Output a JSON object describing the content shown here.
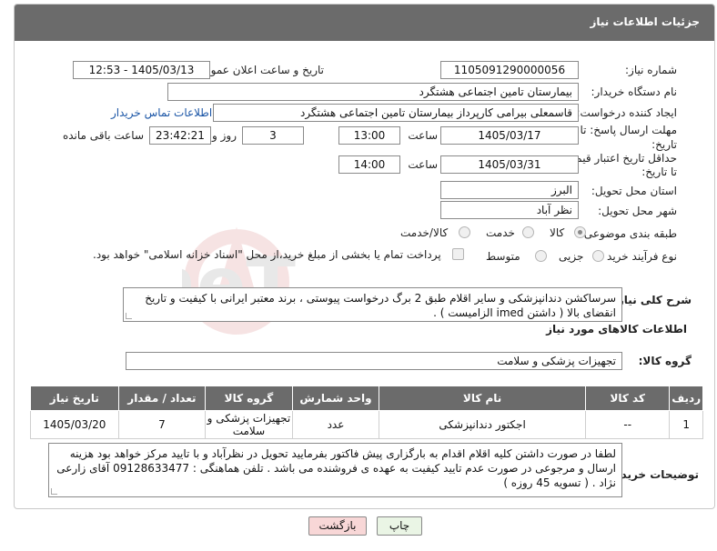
{
  "header": {
    "title": "جزئیات اطلاعات نیاز"
  },
  "fields": {
    "need_number_label": "شماره نیاز:",
    "need_number": "1105091290000056",
    "announce_label": "تاریخ و ساعت اعلان عمومی:",
    "announce_value": "1405/03/13 - 12:53",
    "buyer_org_label": "نام دستگاه خریدار:",
    "buyer_org": "بیمارستان تامین اجتماعی هشتگرد",
    "creator_label": "ایجاد کننده درخواست:",
    "creator": "قاسمعلی بیرامی کارپرداز بیمارستان تامین اجتماعی هشتگرد",
    "contact_link": "اطلاعات تماس خریدار",
    "reply_deadline_label_1": "مهلت ارسال پاسخ: تا",
    "reply_deadline_label_2": "تاریخ:",
    "reply_date": "1405/03/17",
    "time_label": "ساعت",
    "reply_time": "13:00",
    "days_value": "3",
    "days_label": "روز و",
    "remaining_time": "23:42:21",
    "remaining_label": "ساعت باقی مانده",
    "price_validity_label_1": "حداقل تاریخ اعتبار قیمت:",
    "price_validity_label_2": "تا تاریخ:",
    "price_date": "1405/03/31",
    "price_time": "14:00",
    "province_label": "استان محل تحویل:",
    "province": "البرز",
    "city_label": "شهر محل تحویل:",
    "city": "نظر آباد",
    "category_label": "طبقه بندی موضوعی:",
    "category_options": [
      "کالا",
      "خدمت",
      "کالا/خدمت"
    ],
    "purchase_type_label": "نوع فرآیند خرید :",
    "purchase_options": [
      "جزیی",
      "متوسط"
    ],
    "payment_note": "پرداخت تمام یا بخشی از مبلغ خرید،از محل \"اسناد خزانه اسلامی\" خواهد بود."
  },
  "description": {
    "label": "شرح کلی نیاز:",
    "text": "سرساکشن دندانپزشکی و سایر اقلام طبق 2 برگ درخواست پیوستی ، برند معتبر ایرانی با کیفیت و تاریخ انقضای بالا ( داشتن imed  الزامیست ) ."
  },
  "goods_section": {
    "title": "اطلاعات کالاهای مورد نیاز",
    "group_label": "گروه کالا:",
    "group_value": "تجهیزات پزشکی و سلامت"
  },
  "table": {
    "headers": [
      "ردیف",
      "کد کالا",
      "نام کالا",
      "واحد شمارش",
      "گروه کالا",
      "تعداد / مقدار",
      "تاریخ نیاز"
    ],
    "rows": [
      [
        "1",
        "--",
        "اجکتور دندانپزشکی",
        "عدد",
        "تجهیزات پزشکی و سلامت",
        "7",
        "1405/03/20"
      ]
    ]
  },
  "buyer_notes": {
    "label": "توضیحات خریدار:",
    "text": "لطفا در صورت داشتن کلیه اقلام اقدام به بارگزاری پیش فاکتور بفرمایید تحویل در نظرآباد و با تایید مرکز خواهد بود هزینه ارسال و مرجوعی در صورت عدم تایید کیفیت به عهده ی فروشنده می باشد . تلفن هماهنگی : 09128633477  آقای زارعی نژاد . ( تسویه 45 روزه )"
  },
  "buttons": {
    "print": "چاپ",
    "back": "بازگشت"
  },
  "watermark_text": "AriaTender.neT",
  "colors": {
    "header_bg": "#6b6b6b",
    "link": "#1a55a6",
    "back_button_bg": "#f8d7d7",
    "print_button_bg": "#eaf5e5"
  }
}
